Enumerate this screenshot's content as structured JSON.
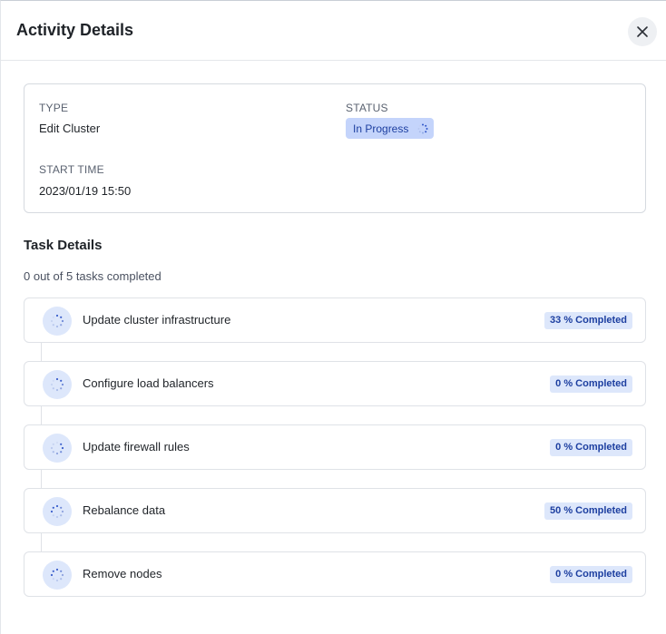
{
  "header": {
    "title": "Activity Details",
    "close_icon": "close-icon"
  },
  "summary": {
    "type_label": "TYPE",
    "type_value": "Edit Cluster",
    "status_label": "STATUS",
    "status_value": "In Progress",
    "start_time_label": "START TIME",
    "start_time_value": "2023/01/19 15:50"
  },
  "task_details": {
    "title": "Task Details",
    "summary": "0 out of 5 tasks completed",
    "tasks": [
      {
        "label": "Update cluster infrastructure",
        "badge": "33 % Completed",
        "icon": "spinner-icon"
      },
      {
        "label": "Configure load balancers",
        "badge": "0 % Completed",
        "icon": "spinner-icon"
      },
      {
        "label": "Update firewall rules",
        "badge": "0 % Completed",
        "icon": "spinner-icon"
      },
      {
        "label": "Rebalance data",
        "badge": "50 % Completed",
        "icon": "spinner-icon"
      },
      {
        "label": "Remove nodes",
        "badge": "0 % Completed",
        "icon": "spinner-icon"
      }
    ]
  },
  "colors": {
    "accent": "#1d3fa0",
    "badge_bg": "#dde7fb",
    "status_bg": "#c4d4fb"
  }
}
